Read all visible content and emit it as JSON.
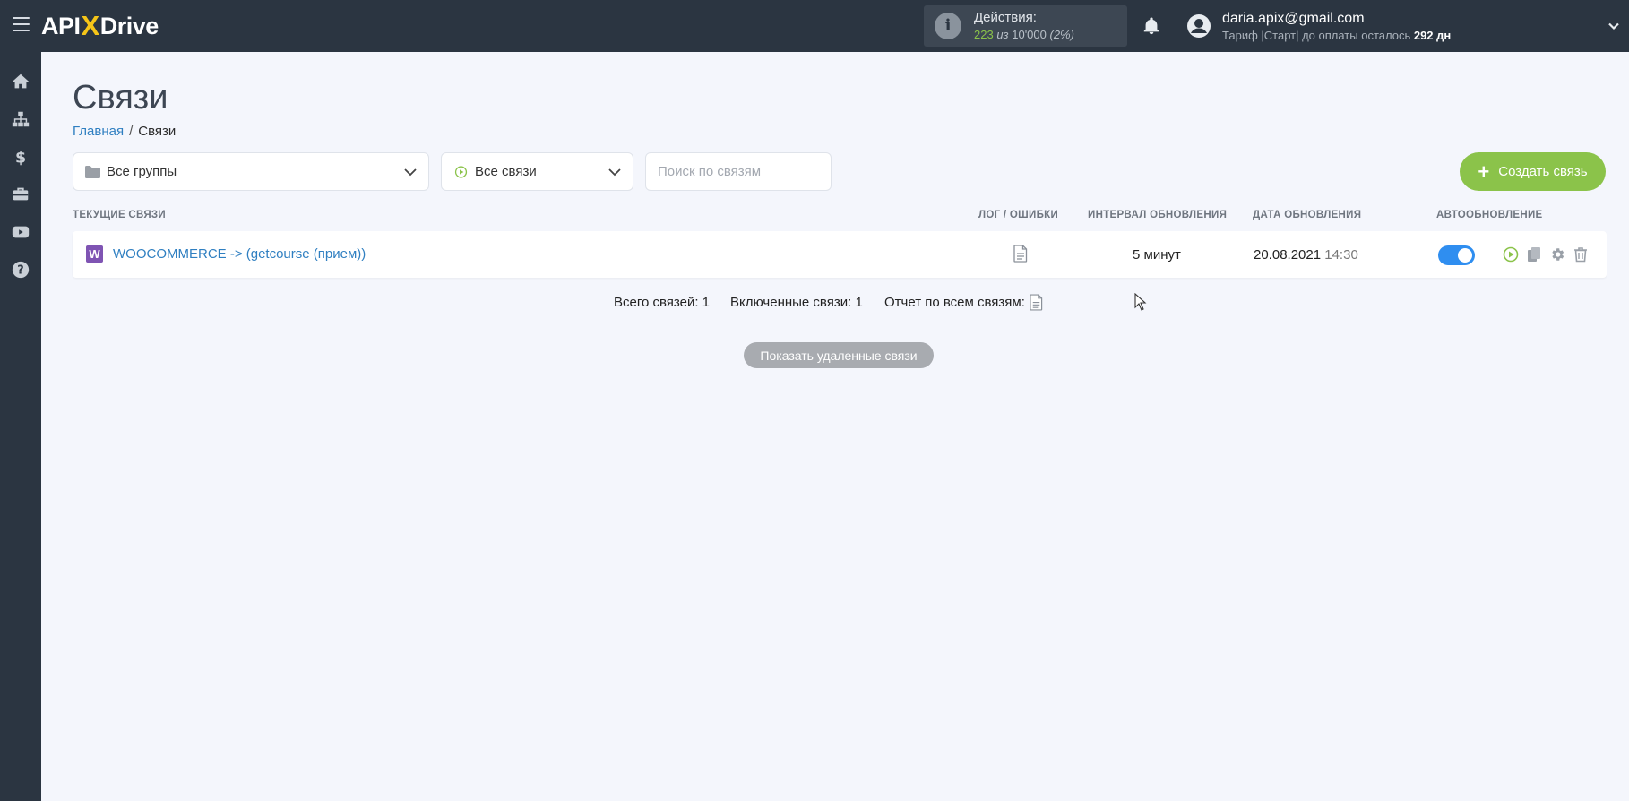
{
  "header": {
    "logo": {
      "left": "API",
      "x": "X",
      "right": "Drive"
    },
    "actions": {
      "title": "Действия:",
      "used": "223",
      "of": "из",
      "total": "10'000",
      "percent": "(2%)"
    },
    "user": {
      "email": "daria.apix@gmail.com",
      "plan_prefix": "Тариф |Старт| до оплаты осталось",
      "days": "292 дн"
    }
  },
  "sidebar": {
    "items": [
      {
        "icon": "home-icon"
      },
      {
        "icon": "sitemap-icon"
      },
      {
        "icon": "dollar-icon"
      },
      {
        "icon": "briefcase-icon"
      },
      {
        "icon": "video-icon"
      },
      {
        "icon": "help-icon"
      }
    ]
  },
  "page": {
    "title": "Связи",
    "breadcrumb": {
      "home": "Главная",
      "separator": "/",
      "current": "Связи"
    }
  },
  "filters": {
    "groups_value": "Все группы",
    "links_value": "Все связи",
    "search_placeholder": "Поиск по связям"
  },
  "create_button": {
    "plus": "+",
    "label": "Создать связь"
  },
  "table": {
    "columns": {
      "current": "ТЕКУЩИЕ СВЯЗИ",
      "log": "ЛОГ / ОШИБКИ",
      "interval": "ИНТЕРВАЛ ОБНОВЛЕНИЯ",
      "date": "ДАТА ОБНОВЛЕНИЯ",
      "auto": "АВТООБНОВЛЕНИЕ"
    },
    "rows": [
      {
        "service_badge": "W",
        "name": "WOOCOMMERCE -> (getcourse (прием))",
        "interval": "5 минут",
        "date": "20.08.2021",
        "time": "14:30",
        "auto_update": true
      }
    ]
  },
  "stats": {
    "total": "Всего связей: 1",
    "enabled": "Включенные связи: 1",
    "report": "Отчет по всем связям:"
  },
  "show_deleted": "Показать удаленные связи",
  "colors": {
    "topbar": "#2b3541",
    "accent_green": "#8bc34a",
    "link_blue": "#2f7fc1",
    "toggle_blue": "#2f8ef0",
    "woo_purple": "#7f54b3"
  }
}
